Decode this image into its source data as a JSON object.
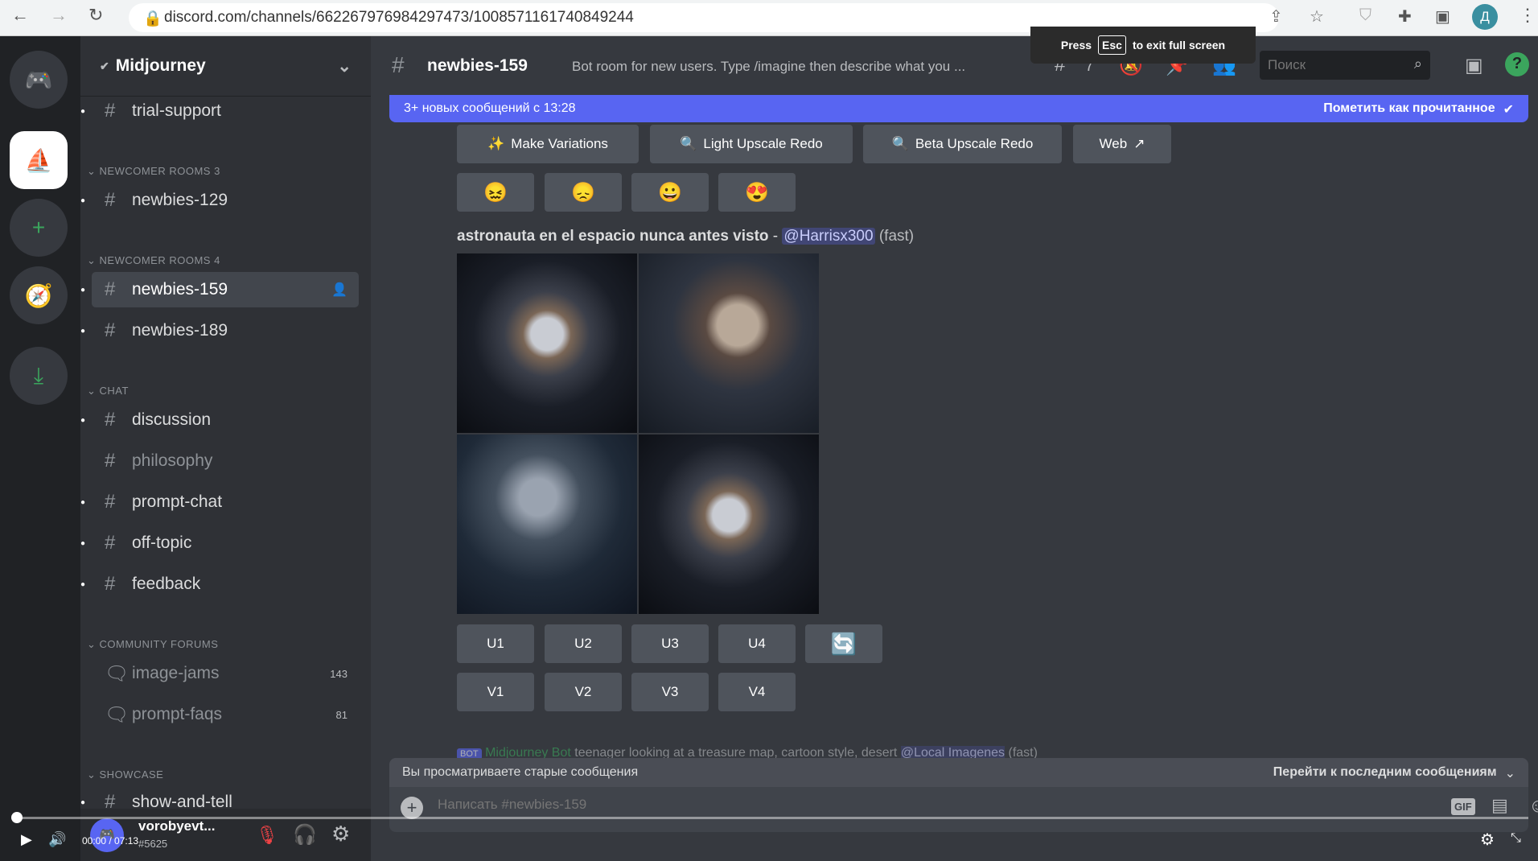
{
  "browser": {
    "url": "discord.com/channels/662267976984297473/1008571161740849244",
    "profile_initial": "Д"
  },
  "fullscreen_toast": {
    "press": "Press",
    "key": "Esc",
    "rest": "to exit full screen"
  },
  "server": {
    "name": "Midjourney"
  },
  "sidebar": {
    "items": [
      {
        "type": "channel",
        "label": "trial-support"
      },
      {
        "type": "category",
        "label": "NEWCOMER ROOMS 3"
      },
      {
        "type": "channel",
        "label": "newbies-129"
      },
      {
        "type": "category",
        "label": "NEWCOMER ROOMS 4"
      },
      {
        "type": "channel",
        "label": "newbies-159",
        "selected": true
      },
      {
        "type": "channel",
        "label": "newbies-189"
      },
      {
        "type": "category",
        "label": "CHAT"
      },
      {
        "type": "channel",
        "label": "discussion"
      },
      {
        "type": "channel",
        "label": "philosophy"
      },
      {
        "type": "channel",
        "label": "prompt-chat"
      },
      {
        "type": "channel",
        "label": "off-topic"
      },
      {
        "type": "channel",
        "label": "feedback"
      },
      {
        "type": "category",
        "label": "COMMUNITY FORUMS"
      },
      {
        "type": "forum",
        "label": "image-jams",
        "count": "143"
      },
      {
        "type": "forum",
        "label": "prompt-faqs",
        "count": "81"
      },
      {
        "type": "category",
        "label": "SHOWCASE"
      },
      {
        "type": "channel",
        "label": "show-and-tell"
      }
    ]
  },
  "user": {
    "name": "vorobyevt...",
    "tag": "#5625"
  },
  "header": {
    "channel": "newbies-159",
    "topic": "Bot room for new users. Type /imagine then describe what you ...",
    "threads": "7",
    "search_placeholder": "Поиск"
  },
  "banner": {
    "text": "3+ новых сообщений с 13:28",
    "mark_read": "Пометить как прочитанное"
  },
  "message": {
    "actions": [
      "Make Variations",
      "Light Upscale Redo",
      "Beta Upscale Redo",
      "Web"
    ],
    "reactions": [
      "😖",
      "😞",
      "😀",
      "😍"
    ],
    "prompt": "astronauta en el espacio nunca antes visto",
    "separator": " - ",
    "mention": "@Harrisx300",
    "mode": "(fast)",
    "upscale": [
      "U1",
      "U2",
      "U3",
      "U4"
    ],
    "variation": [
      "V1",
      "V2",
      "V3",
      "V4"
    ]
  },
  "next_message": {
    "badge": "BOT",
    "author": "Midjourney Bot",
    "text": "teenager looking at a treasure map, cartoon style, desert",
    "mention": "@Local Imagenes",
    "mode": "(fast)"
  },
  "old_bar": {
    "text": "Вы просматриваете старые сообщения",
    "jump": "Перейти к последним сообщениям"
  },
  "composer": {
    "placeholder": "Написать #newbies-159"
  },
  "video": {
    "time": "00:00 / 07:13",
    "progress": 0
  }
}
